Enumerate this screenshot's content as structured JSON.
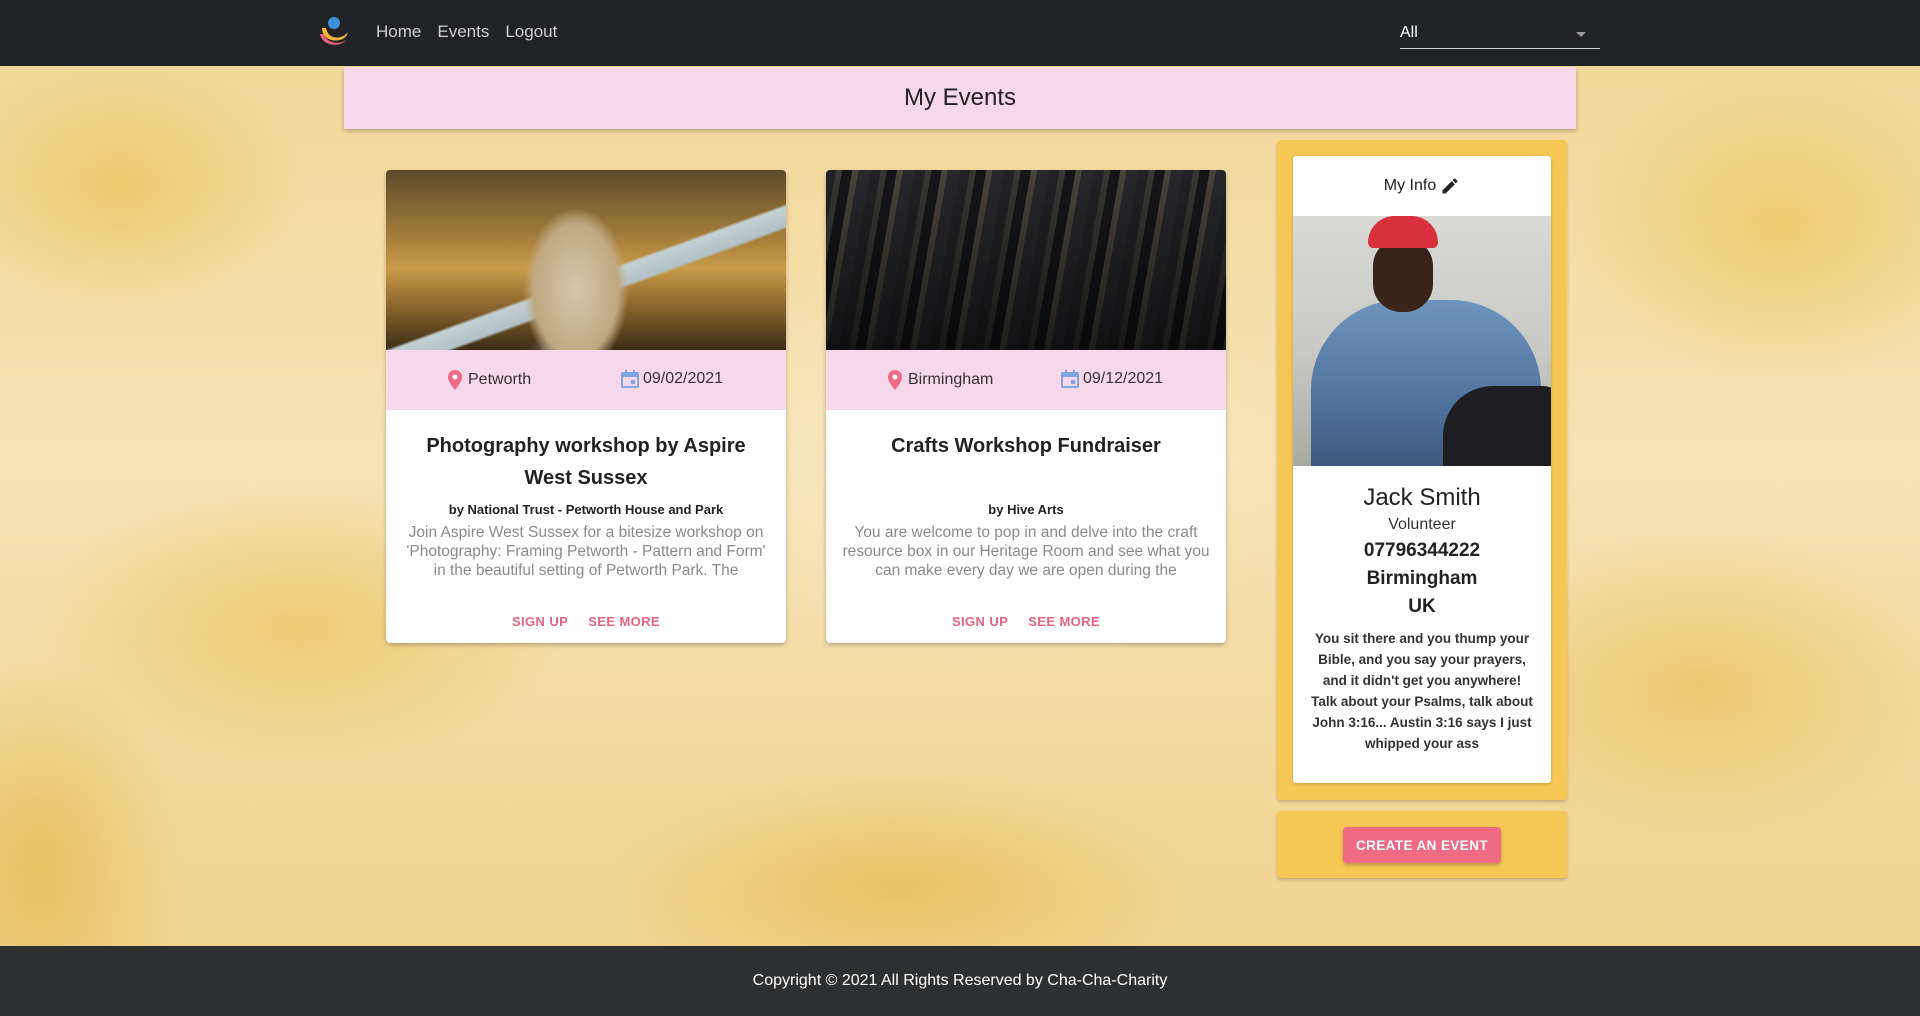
{
  "topbar": {
    "nav": [
      "Home",
      "Events",
      "Logout"
    ],
    "filter_value": "All"
  },
  "page": {
    "title": "My Events"
  },
  "events": [
    {
      "location": "Petworth",
      "date": "09/02/2021",
      "title": "Photography workshop by Aspire West Sussex",
      "organizer": "by National Trust - Petworth House and Park",
      "description": "Join Aspire West Sussex for a bitesize workshop on 'Photography: Framing Petworth - Pattern and Form' in the beautiful setting of Petworth Park. The",
      "signup_label": "SIGN UP",
      "more_label": "SEE MORE"
    },
    {
      "location": "Birmingham",
      "date": "09/12/2021",
      "title": "Crafts Workshop Fundraiser",
      "organizer": "by Hive Arts",
      "description": "You are welcome to pop in and delve into the craft resource box in our Heritage Room and see what you can make every day we are open during the",
      "signup_label": "SIGN UP",
      "more_label": "SEE MORE"
    }
  ],
  "profile": {
    "heading": "My Info",
    "name": "Jack Smith",
    "role": "Volunteer",
    "phone": "07796344222",
    "city": "Birmingham",
    "country": "UK",
    "bio": "You sit there and you thump your Bible, and you say your prayers, and it didn't get you anywhere! Talk about your Psalms, talk about John 3:16... Austin 3:16 says I just whipped your ass"
  },
  "actions": {
    "create_event_label": "CREATE AN EVENT"
  },
  "footer": {
    "text": "Copyright © 2021 All Rights Reserved by Cha-Cha-Charity"
  },
  "colors": {
    "topbar": "#212327",
    "accent_pink": "#f7d7ea",
    "link_pink": "#e5657f",
    "panel_yellow": "#f5c754",
    "button_pink": "#ef6b84",
    "footer": "#2e2f30"
  },
  "icons": [
    "app-logo-icon",
    "location-pin-icon",
    "calendar-icon",
    "edit-pencil-icon",
    "dropdown-caret-icon"
  ]
}
